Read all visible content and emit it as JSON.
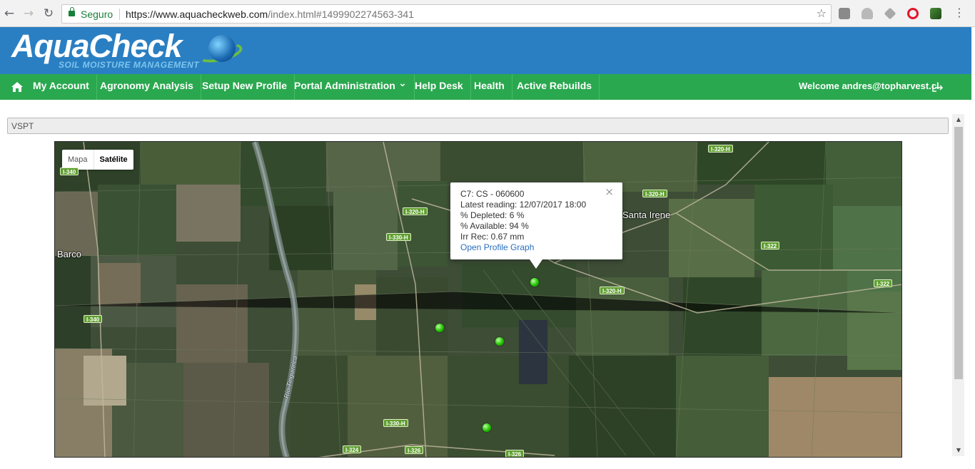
{
  "browser": {
    "secure_label": "Seguro",
    "url_host": "https://www.aquacheckweb.com",
    "url_rest": "/index.html#1499902274563-341",
    "back_icon": "arrow-left-icon",
    "forward_icon": "arrow-right-icon",
    "reload_icon": "reload-icon",
    "star_icon": "star-icon",
    "menu_icon": "vertical-dots-icon"
  },
  "brand": {
    "name": "AquaCheck",
    "tagline": "SOIL MOISTURE MANAGEMENT"
  },
  "nav": {
    "items": [
      {
        "label": "My Account"
      },
      {
        "label": "Agronomy Analysis"
      },
      {
        "label": "Setup New Profile"
      },
      {
        "label": "Portal Administration"
      },
      {
        "label": "Help Desk"
      },
      {
        "label": "Health"
      },
      {
        "label": "Active Rebuilds"
      }
    ],
    "dropdown_glyph": "⌄",
    "welcome": "Welcome andres@topharvest.cl"
  },
  "selector": {
    "value": "VSPT"
  },
  "map": {
    "type_buttons": {
      "map": "Mapa",
      "satellite": "Satélite"
    },
    "active_type": "Satélite",
    "road_labels": {
      "l1": "I-340",
      "l2": "I-340",
      "l3": "I-320-H",
      "l4": "I-330-H",
      "l5": "I-320-H",
      "l6": "I-320-H",
      "l7": "I-320-H",
      "l8": "I-322",
      "l9": "I-322",
      "l10": "I-330-H",
      "l11": "I-324",
      "l12": "I-326",
      "l13": "I-326"
    },
    "places": {
      "barco": "Barco",
      "santa_irene": "Santa Irene"
    },
    "river": "Río Tinguiririca",
    "infowindow": {
      "title": "C7: CS - 060600",
      "latest_reading": "Latest reading: 12/07/2017 18:00",
      "depleted": "% Depleted: 6 %",
      "available": "% Available: 94 %",
      "irr_rec": "Irr Rec: 0.67 mm",
      "link": "Open Profile Graph",
      "close": "×"
    },
    "colors": {
      "marker": "#22c400",
      "field_dark": "#2f4229",
      "field_mid": "#4a5e3a",
      "field_light": "#8b8c69"
    }
  },
  "colors": {
    "header_blue": "#2a7fc2",
    "nav_green": "#2aa84f"
  }
}
